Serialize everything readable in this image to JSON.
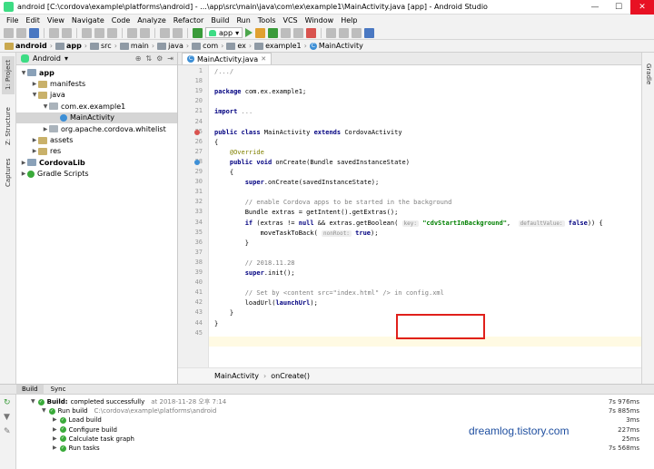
{
  "window": {
    "title": "android [C:\\cordova\\example\\platforms\\android] - ...\\app\\src\\main\\java\\com\\ex\\example1\\MainActivity.java [app] - Android Studio",
    "minimize": "—",
    "maximize": "☐",
    "close": "✕"
  },
  "menu": [
    "File",
    "Edit",
    "View",
    "Navigate",
    "Code",
    "Analyze",
    "Refactor",
    "Build",
    "Run",
    "Tools",
    "VCS",
    "Window",
    "Help"
  ],
  "toolbar": {
    "run_config": "app"
  },
  "breadcrumb": [
    "android",
    "app",
    "src",
    "main",
    "java",
    "com",
    "ex",
    "example1",
    "MainActivity"
  ],
  "project_panel": {
    "view_label": "Android",
    "tree": [
      {
        "label": "app",
        "depth": 0,
        "bold": true,
        "icon": "module-icon",
        "expanded": true
      },
      {
        "label": "manifests",
        "depth": 1,
        "icon": "folder-icon",
        "expanded": false
      },
      {
        "label": "java",
        "depth": 1,
        "icon": "folder-icon",
        "expanded": true
      },
      {
        "label": "com.ex.example1",
        "depth": 2,
        "icon": "package-icon",
        "expanded": true
      },
      {
        "label": "MainActivity",
        "depth": 3,
        "icon": "class-icon",
        "selected": true
      },
      {
        "label": "org.apache.cordova.whitelist",
        "depth": 2,
        "icon": "package-icon",
        "expanded": false
      },
      {
        "label": "assets",
        "depth": 1,
        "icon": "folder-icon",
        "expanded": false
      },
      {
        "label": "res",
        "depth": 1,
        "icon": "folder-icon",
        "expanded": false
      },
      {
        "label": "CordovaLib",
        "depth": 0,
        "bold": true,
        "icon": "module-icon",
        "expanded": false
      },
      {
        "label": "Gradle Scripts",
        "depth": 0,
        "icon": "gradle-icon",
        "expanded": false
      }
    ]
  },
  "left_tabs": [
    "1: Project",
    "Z: Structure",
    "Captures"
  ],
  "right_tabs": [
    "Gradle"
  ],
  "editor": {
    "tab_label": "MainActivity.java",
    "lines": [
      {
        "n": "1",
        "html": "<span class=\"fold\">/.../</span>"
      },
      {
        "n": "18",
        "html": ""
      },
      {
        "n": "19",
        "html": "<span class=\"kw\">package</span> com.ex.example1;"
      },
      {
        "n": "20",
        "html": ""
      },
      {
        "n": "21",
        "html": "<span class=\"kw\">import</span> <span class=\"fold\">...</span>"
      },
      {
        "n": "24",
        "html": ""
      },
      {
        "n": "25",
        "html": "<span class=\"kw\">public class</span> MainActivity <span class=\"kw\">extends</span> CordovaActivity"
      },
      {
        "n": "26",
        "html": "{"
      },
      {
        "n": "27",
        "html": "    <span class=\"an\">@Override</span>"
      },
      {
        "n": "28",
        "html": "    <span class=\"kw\">public void</span> onCreate(Bundle savedInstanceState)"
      },
      {
        "n": "29",
        "html": "    {"
      },
      {
        "n": "30",
        "html": "        <span class=\"kw\">super</span>.onCreate(savedInstanceState);"
      },
      {
        "n": "31",
        "html": ""
      },
      {
        "n": "32",
        "html": "        <span class=\"cm\">// enable Cordova apps to be started in the background</span>"
      },
      {
        "n": "33",
        "html": "        Bundle extras = getIntent().getExtras();"
      },
      {
        "n": "34",
        "html": "        <span class=\"kw\">if</span> (extras != <span class=\"kw\">null</span> &amp;&amp; extras.getBoolean( <span class=\"hint\">key:</span> <span class=\"st\">\"cdvStartInBackground\"</span>,  <span class=\"hint\">defaultValue:</span> <span class=\"kw\">false</span>)) {"
      },
      {
        "n": "35",
        "html": "            moveTaskToBack( <span class=\"hint\">nonRoot:</span> <span class=\"kw\">true</span>);"
      },
      {
        "n": "36",
        "html": "        }"
      },
      {
        "n": "37",
        "html": ""
      },
      {
        "n": "38",
        "html": "        <span class=\"cm\">// 2018.11.28</span>"
      },
      {
        "n": "39",
        "html": "        <span class=\"kw\">super</span>.init();"
      },
      {
        "n": "40",
        "html": ""
      },
      {
        "n": "41",
        "html": "        <span class=\"cm\">// Set by &lt;content src=\"index.html\" /&gt; in config.xml</span>"
      },
      {
        "n": "42",
        "html": "        loadUrl(<span class=\"kw\">launchUrl</span>);"
      },
      {
        "n": "43",
        "html": "    }"
      },
      {
        "n": "44",
        "html": "}"
      },
      {
        "n": "45",
        "html": ""
      }
    ],
    "bottom_breadcrumb": [
      "MainActivity",
      "onCreate()"
    ]
  },
  "build": {
    "tabs": [
      "Build",
      "Sync"
    ],
    "rows": [
      {
        "depth": 0,
        "title": "Build:",
        "text": "completed successfully",
        "extra": "at 2018-11-28 오후 7:14",
        "dur": "7s 976ms"
      },
      {
        "depth": 1,
        "title": "",
        "text": "Run build",
        "extra": "C:\\cordova\\example\\platforms\\android",
        "dur": "7s 885ms"
      },
      {
        "depth": 2,
        "title": "",
        "text": "Load build",
        "extra": "",
        "dur": "3ms"
      },
      {
        "depth": 2,
        "title": "",
        "text": "Configure build",
        "extra": "",
        "dur": "227ms"
      },
      {
        "depth": 2,
        "title": "",
        "text": "Calculate task graph",
        "extra": "",
        "dur": "25ms"
      },
      {
        "depth": 2,
        "title": "",
        "text": "Run tasks",
        "extra": "",
        "dur": "7s 568ms"
      }
    ],
    "watermark": "dreamlog.tistory.com"
  }
}
